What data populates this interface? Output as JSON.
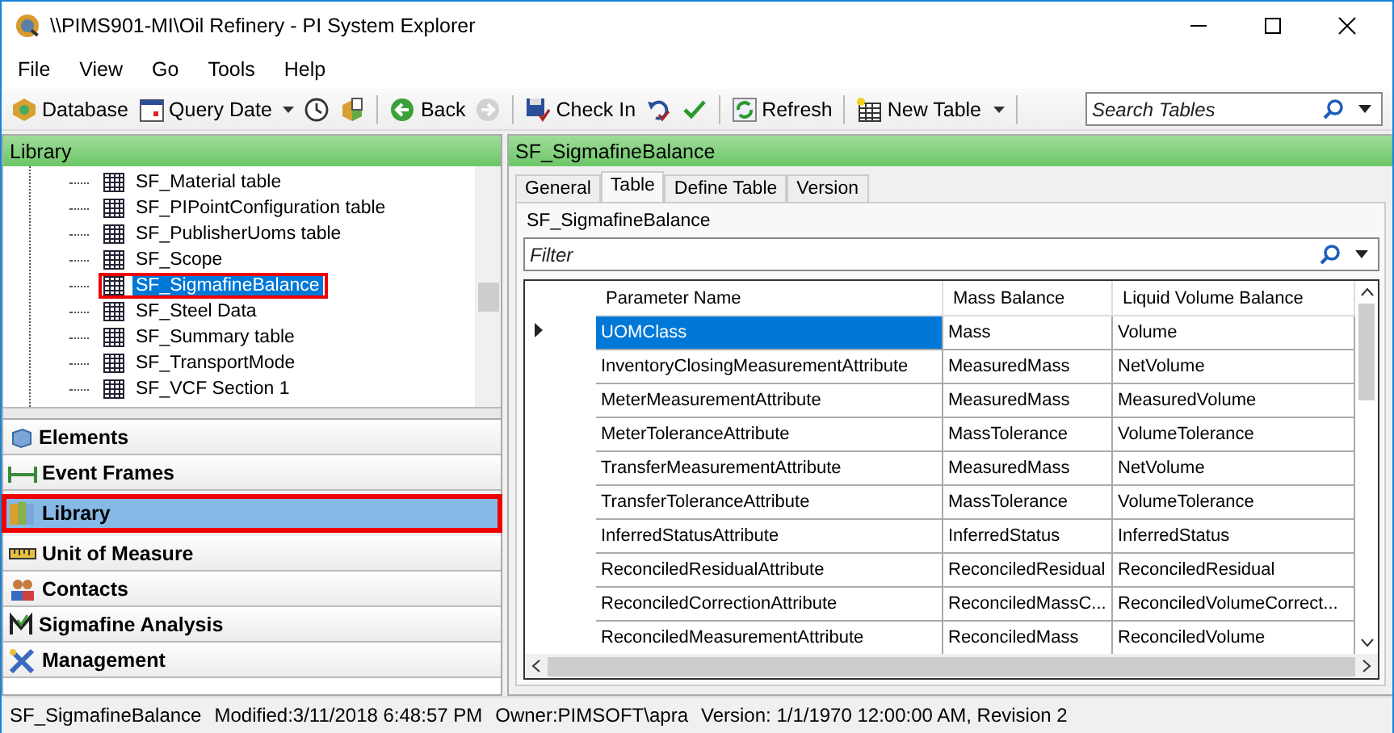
{
  "window": {
    "title": "\\\\PIMS901-MI\\Oil Refinery - PI System Explorer"
  },
  "menu": [
    "File",
    "View",
    "Go",
    "Tools",
    "Help"
  ],
  "toolbar": [
    {
      "kind": "text",
      "label": "Database",
      "dropdown": false,
      "disabled": false
    },
    {
      "kind": "text",
      "label": "Query Date",
      "dropdown": true,
      "disabled": false
    },
    {
      "kind": "icon",
      "dropdown": false,
      "disabled": false
    },
    {
      "kind": "icon",
      "dropdown": false,
      "disabled": false
    },
    {
      "kind": "text",
      "label": "Back",
      "dropdown": false,
      "disabled": false
    },
    {
      "kind": "icon",
      "dropdown": false,
      "disabled": true
    },
    {
      "kind": "text",
      "label": "Check In",
      "dropdown": false,
      "disabled": false
    },
    {
      "kind": "icon",
      "dropdown": false,
      "disabled": false
    },
    {
      "kind": "icon",
      "dropdown": false,
      "disabled": false
    },
    {
      "kind": "text",
      "label": "Refresh",
      "dropdown": false,
      "disabled": false
    },
    {
      "kind": "text",
      "label": "New Table",
      "dropdown": true,
      "disabled": false
    }
  ],
  "search": {
    "placeholder": "Search Tables"
  },
  "library": {
    "title": "Library",
    "tree": [
      {
        "label": "SF_Material table",
        "selected": false,
        "highlighted": false
      },
      {
        "label": "SF_PIPointConfiguration table",
        "selected": false,
        "highlighted": false
      },
      {
        "label": "SF_PublisherUoms table",
        "selected": false,
        "highlighted": false
      },
      {
        "label": "SF_Scope",
        "selected": false,
        "highlighted": false
      },
      {
        "label": "SF_SigmafineBalance",
        "selected": true,
        "highlighted": true
      },
      {
        "label": "SF_Steel Data",
        "selected": false,
        "highlighted": false
      },
      {
        "label": "SF_Summary table",
        "selected": false,
        "highlighted": false
      },
      {
        "label": "SF_TransportMode",
        "selected": false,
        "highlighted": false
      },
      {
        "label": "SF_VCF Section 1",
        "selected": false,
        "highlighted": false
      }
    ]
  },
  "navigation": [
    {
      "label": "Elements",
      "selected": false,
      "highlighted": false
    },
    {
      "label": "Event Frames",
      "selected": false,
      "highlighted": false
    },
    {
      "label": "Library",
      "selected": true,
      "highlighted": true
    },
    {
      "label": "Unit of Measure",
      "selected": false,
      "highlighted": false
    },
    {
      "label": "Contacts",
      "selected": false,
      "highlighted": false
    },
    {
      "label": "Sigmafine Analysis",
      "selected": false,
      "highlighted": false
    },
    {
      "label": "Management",
      "selected": false,
      "highlighted": false
    }
  ],
  "detail": {
    "title": "SF_SigmafineBalance",
    "tabs": [
      {
        "label": "General",
        "selected": false
      },
      {
        "label": "Table",
        "selected": true
      },
      {
        "label": "Define Table",
        "selected": false
      },
      {
        "label": "Version",
        "selected": false
      }
    ],
    "table_name": "SF_SigmafineBalance",
    "filter": {
      "placeholder": "Filter"
    },
    "table": {
      "columns": [
        "Parameter Name",
        "Mass Balance",
        "Liquid Volume Balance"
      ],
      "rows": [
        {
          "cells": [
            "UOMClass",
            "Mass",
            "Volume"
          ],
          "selected": true
        },
        {
          "cells": [
            "InventoryClosingMeasurementAttribute",
            "MeasuredMass",
            "NetVolume"
          ],
          "selected": false
        },
        {
          "cells": [
            "MeterMeasurementAttribute",
            "MeasuredMass",
            "MeasuredVolume"
          ],
          "selected": false
        },
        {
          "cells": [
            "MeterToleranceAttribute",
            "MassTolerance",
            "VolumeTolerance"
          ],
          "selected": false
        },
        {
          "cells": [
            "TransferMeasurementAttribute",
            "MeasuredMass",
            "NetVolume"
          ],
          "selected": false
        },
        {
          "cells": [
            "TransferToleranceAttribute",
            "MassTolerance",
            "VolumeTolerance"
          ],
          "selected": false
        },
        {
          "cells": [
            "InferredStatusAttribute",
            "InferredStatus",
            "InferredStatus"
          ],
          "selected": false
        },
        {
          "cells": [
            "ReconciledResidualAttribute",
            "ReconciledResidual",
            "ReconciledResidual"
          ],
          "selected": false
        },
        {
          "cells": [
            "ReconciledCorrectionAttribute",
            "ReconciledMassC...",
            "ReconciledVolumeCorrect..."
          ],
          "selected": false
        },
        {
          "cells": [
            "ReconciledMeasurementAttribute",
            "ReconciledMass",
            "ReconciledVolume"
          ],
          "selected": false
        }
      ]
    }
  },
  "status_bar": [
    "SF_SigmafineBalance",
    "Modified:3/11/2018 6:48:57 PM",
    "Owner:PIMSOFT\\apra",
    "Version: 1/1/1970 12:00:00 AM, Revision 2"
  ]
}
